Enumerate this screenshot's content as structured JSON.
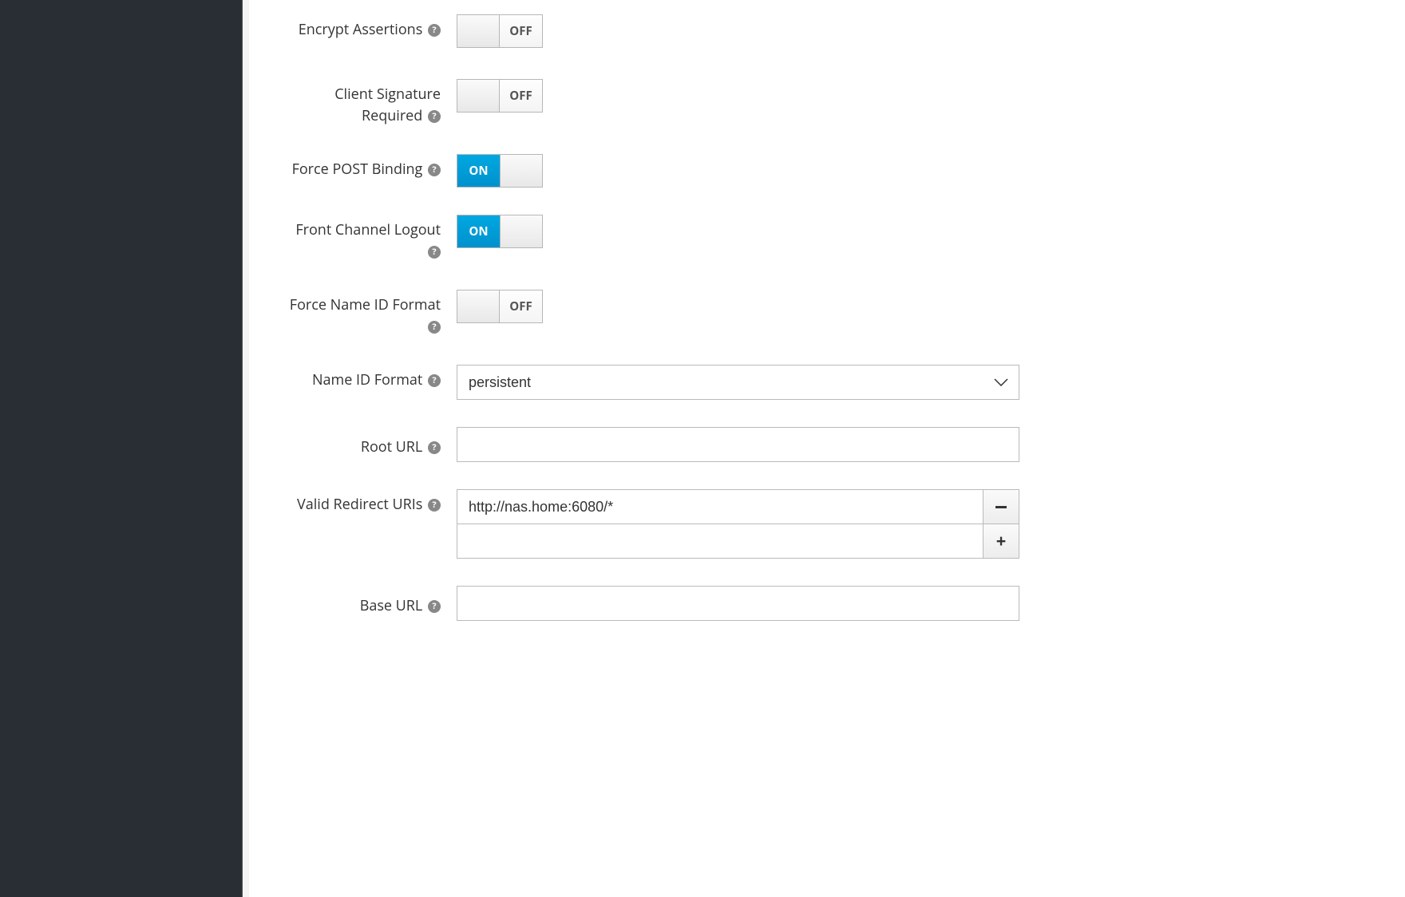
{
  "toggles": {
    "encrypt_assertions": {
      "label": "Encrypt Assertions",
      "state": "off",
      "text": "OFF"
    },
    "client_signature_required": {
      "label": "Client Signature Required",
      "state": "off",
      "text": "OFF"
    },
    "force_post_binding": {
      "label": "Force POST Binding",
      "state": "on",
      "text": "ON"
    },
    "front_channel_logout": {
      "label": "Front Channel Logout",
      "state": "on",
      "text": "ON"
    },
    "force_name_id_format": {
      "label": "Force Name ID Format",
      "state": "off",
      "text": "OFF"
    }
  },
  "name_id_format": {
    "label": "Name ID Format",
    "value": "persistent"
  },
  "root_url": {
    "label": "Root URL",
    "value": ""
  },
  "valid_redirect_uris": {
    "label": "Valid Redirect URIs",
    "items": [
      "http://nas.home:6080/*"
    ],
    "new_value": ""
  },
  "base_url": {
    "label": "Base URL",
    "value": ""
  }
}
